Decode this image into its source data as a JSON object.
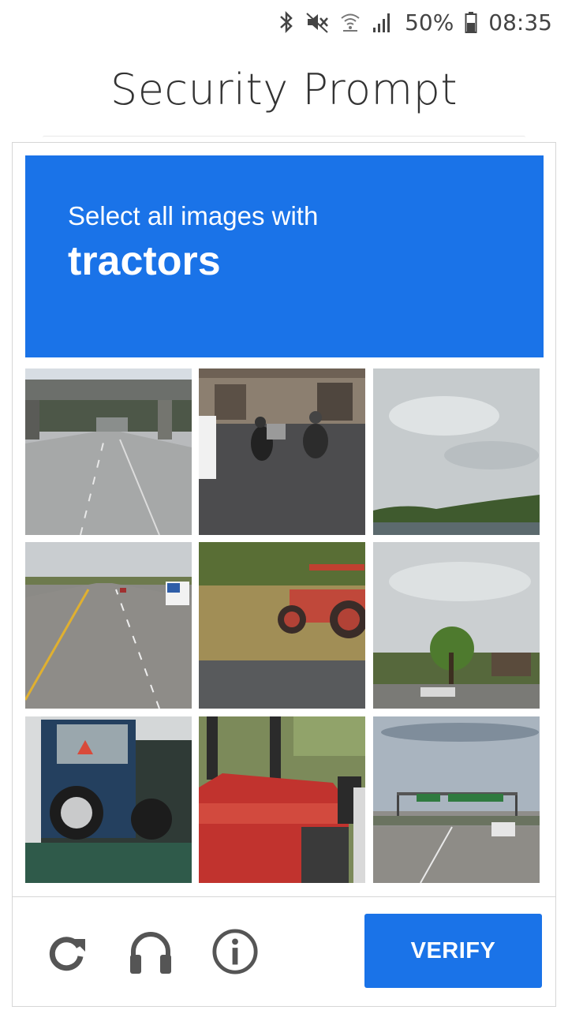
{
  "status_bar": {
    "battery": "50%",
    "time": "08:35",
    "icons": [
      "bluetooth-icon",
      "mute-icon",
      "wifi-icon",
      "signal-icon",
      "battery-icon"
    ]
  },
  "page": {
    "title": "Security Prompt"
  },
  "captcha": {
    "instruction": "Select all images with",
    "object": "tractors",
    "tiles": [
      {
        "scene": "highway-overpass"
      },
      {
        "scene": "scooters-on-street"
      },
      {
        "scene": "sky-and-river"
      },
      {
        "scene": "highway-with-truck"
      },
      {
        "scene": "red-tractor-on-grass"
      },
      {
        "scene": "trees-and-sky"
      },
      {
        "scene": "blue-tractor"
      },
      {
        "scene": "red-tractor-closeup"
      },
      {
        "scene": "highway-with-sign"
      }
    ],
    "footer": {
      "reload_icon": "reload-icon",
      "audio_icon": "headphones-icon",
      "info_icon": "info-icon",
      "verify_label": "VERIFY"
    }
  },
  "colors": {
    "accent": "#1a73e8",
    "text": "#333333",
    "icon_gray": "#555555"
  }
}
